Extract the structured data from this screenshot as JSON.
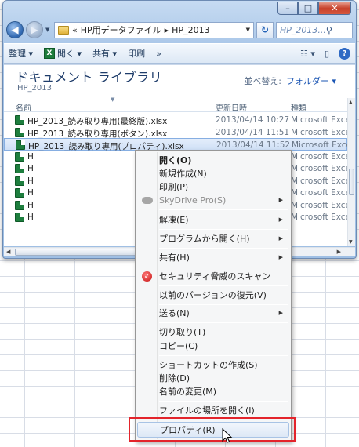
{
  "window": {
    "caption_buttons": {
      "minimize": "–",
      "maximize": "□",
      "close": "✕"
    },
    "breadcrumb": [
      "«",
      "HP用データファイル",
      "HP_2013"
    ],
    "search_placeholder": "HP_2013...",
    "toolbar": {
      "organize": "整理 ▾",
      "open": "開く ▾",
      "share": "共有 ▾",
      "print": "印刷",
      "more": "»"
    }
  },
  "library": {
    "title": "ドキュメント ライブラリ",
    "subtitle": "HP_2013",
    "arrange_label": "並べ替え:",
    "arrange_value": "フォルダー ▾"
  },
  "columns": [
    "名前",
    "更新日時",
    "種類"
  ],
  "files": [
    {
      "name": "HP_2013_読み取り専用(最終版).xlsx",
      "date": "2013/04/14 10:27",
      "type": "Microsoft Excel"
    },
    {
      "name": "HP_2013_読み取り専用(ボタン).xlsx",
      "date": "2013/04/14 11:51",
      "type": "Microsoft Excel"
    },
    {
      "name": "HP_2013_読み取り専用(プロパティ).xlsx",
      "date": "2013/04/14 11:52",
      "type": "Microsoft Excel"
    },
    {
      "name": "H",
      "date": "",
      "type": "Microsoft Excel"
    },
    {
      "name": "H",
      "date": "",
      "type": "Microsoft Excel"
    },
    {
      "name": "H",
      "date": "",
      "type": "Microsoft Excel"
    },
    {
      "name": "H",
      "date": "",
      "type": "Microsoft Excel"
    },
    {
      "name": "H",
      "date": "",
      "type": "Microsoft Excel"
    },
    {
      "name": "H",
      "date": "",
      "type": "Microsoft Excel"
    }
  ],
  "context_menu": {
    "open": "開く(O)",
    "new": "新規作成(N)",
    "print": "印刷(P)",
    "skydrive": "SkyDrive Pro(S)",
    "extract": "解凍(E)",
    "open_with": "プログラムから開く(H)",
    "share": "共有(H)",
    "security_scan": "セキュリティ脅威のスキャン",
    "restore": "以前のバージョンの復元(V)",
    "send_to": "送る(N)",
    "cut": "切り取り(T)",
    "copy": "コピー(C)",
    "shortcut": "ショートカットの作成(S)",
    "delete": "削除(D)",
    "rename": "名前の変更(M)",
    "open_location": "ファイルの場所を開く(I)",
    "properties": "プロパティ(R)"
  },
  "colors": {
    "highlight": "#e3242b",
    "accent": "#1a55b3"
  }
}
